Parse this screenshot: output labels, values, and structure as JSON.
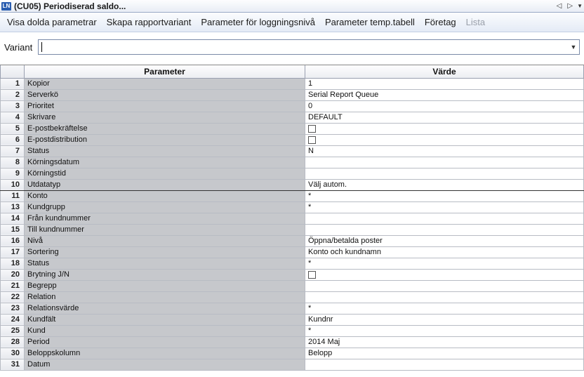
{
  "title": "(CU05) Periodiserad saldo...",
  "app_icon_text": "LN",
  "menu": {
    "show_hidden": "Visa dolda parametrar",
    "create_variant": "Skapa rapportvariant",
    "log_level": "Parameter för loggningsnivå",
    "temp_table": "Parameter temp.tabell",
    "company": "Företag",
    "list": "Lista"
  },
  "variant": {
    "label": "Variant",
    "value": ""
  },
  "columns": {
    "parameter": "Parameter",
    "value": "Värde"
  },
  "rows": [
    {
      "num": "1",
      "param": "Kopior",
      "val": "1"
    },
    {
      "num": "2",
      "param": "Serverkö",
      "val": "Serial Report Queue"
    },
    {
      "num": "3",
      "param": "Prioritet",
      "val": "0"
    },
    {
      "num": "4",
      "param": "Skrivare",
      "val": "DEFAULT"
    },
    {
      "num": "5",
      "param": "E-postbekräftelse",
      "val": "",
      "checkbox": true
    },
    {
      "num": "6",
      "param": "E-postdistribution",
      "val": "",
      "checkbox": true
    },
    {
      "num": "7",
      "param": "Status",
      "val": "N"
    },
    {
      "num": "8",
      "param": "Körningsdatum",
      "val": ""
    },
    {
      "num": "9",
      "param": "Körningstid",
      "val": ""
    },
    {
      "num": "10",
      "param": "Utdatatyp",
      "val": "Välj autom.",
      "section_end": true
    },
    {
      "num": "11",
      "param": "Konto",
      "val": "*"
    },
    {
      "num": "13",
      "param": "Kundgrupp",
      "val": "*"
    },
    {
      "num": "14",
      "param": "Från kundnummer",
      "val": ""
    },
    {
      "num": "15",
      "param": "Till kundnummer",
      "val": ""
    },
    {
      "num": "16",
      "param": "Nivå",
      "val": "Öppna/betalda poster"
    },
    {
      "num": "17",
      "param": "Sortering",
      "val": "Konto och kundnamn"
    },
    {
      "num": "18",
      "param": "Status",
      "val": "*"
    },
    {
      "num": "20",
      "param": "Brytning J/N",
      "val": "",
      "checkbox": true
    },
    {
      "num": "21",
      "param": "Begrepp",
      "val": ""
    },
    {
      "num": "22",
      "param": "Relation",
      "val": ""
    },
    {
      "num": "23",
      "param": "Relationsvärde",
      "val": "*"
    },
    {
      "num": "24",
      "param": "Kundfält",
      "val": "Kundnr"
    },
    {
      "num": "25",
      "param": "Kund",
      "val": "*"
    },
    {
      "num": "28",
      "param": "Period",
      "val": "2014 Maj"
    },
    {
      "num": "30",
      "param": "Beloppskolumn",
      "val": "Belopp"
    },
    {
      "num": "31",
      "param": "Datum",
      "val": ""
    }
  ]
}
